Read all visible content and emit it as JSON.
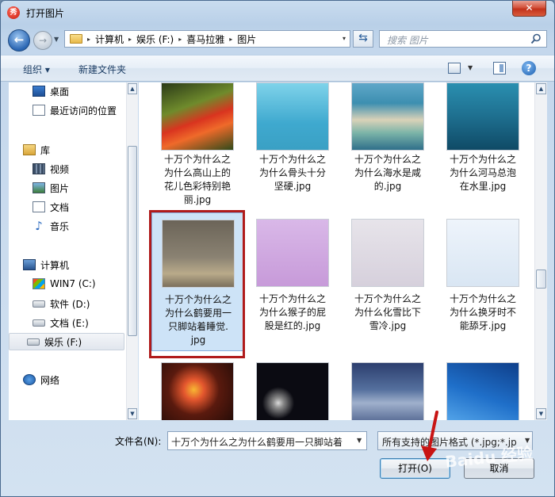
{
  "window": {
    "title": "打开图片",
    "app_icon_glyph": "秀",
    "close_glyph": "✕"
  },
  "address_bar": {
    "breadcrumbs": [
      "计算机",
      "娱乐 (F:)",
      "喜马拉雅",
      "图片"
    ],
    "separator": "▸",
    "dropdown_glyph": "▾"
  },
  "search": {
    "placeholder": "搜索 图片"
  },
  "toolbar": {
    "organize_label": "组织 ▾",
    "new_folder_label": "新建文件夹",
    "help_glyph": "?"
  },
  "nav_pane": {
    "items": [
      {
        "label": "桌面",
        "icon": "desktop-icon"
      },
      {
        "label": "最近访问的位置",
        "icon": "recent-places-icon"
      },
      {
        "label": "库",
        "icon": "library-icon"
      },
      {
        "label": "视频",
        "icon": "video-icon"
      },
      {
        "label": "图片",
        "icon": "pictures-icon"
      },
      {
        "label": "文档",
        "icon": "documents-icon"
      },
      {
        "label": "音乐",
        "icon": "music-icon"
      },
      {
        "label": "计算机",
        "icon": "computer-icon"
      },
      {
        "label": "WIN7 (C:)",
        "icon": "windows-drive-icon"
      },
      {
        "label": "软件 (D:)",
        "icon": "drive-icon"
      },
      {
        "label": "文档 (E:)",
        "icon": "drive-icon"
      },
      {
        "label": "娱乐 (F:)",
        "icon": "drive-icon"
      },
      {
        "label": "网络",
        "icon": "network-icon"
      }
    ],
    "selected_index": 11
  },
  "files": [
    {
      "label": "十万个为什么之\n为什么高山上的\n花儿色彩特别艳\n丽.jpg"
    },
    {
      "label": "十万个为什么之\n为什么骨头十分\n坚硬.jpg"
    },
    {
      "label": "十万个为什么之\n为什么海水是咸\n的.jpg"
    },
    {
      "label": "十万个为什么之\n为什么河马总泡\n在水里.jpg"
    },
    {
      "label": "十万个为什么之\n为什么鹤要用一\n只脚站着睡觉.\njpg"
    },
    {
      "label": "十万个为什么之\n为什么猴子的屁\n股是红的.jpg"
    },
    {
      "label": "十万个为什么之\n为什么化雪比下\n雪冷.jpg"
    },
    {
      "label": "十万个为什么之\n为什么换牙时不\n能舔牙.jpg"
    },
    {
      "label": ""
    },
    {
      "label": ""
    },
    {
      "label": ""
    },
    {
      "label": ""
    }
  ],
  "selected_file_index": 4,
  "bottom": {
    "filename_label": "文件名(N):",
    "filename_value": "十万个为什么之为什么鹤要用一只脚站着",
    "filter_value": "所有支持的图片格式 (*.jpg;*.jp",
    "open_label": "打开(O)",
    "cancel_label": "取消"
  },
  "watermark_text": "Baidu 经验",
  "colors": {
    "highlight_border": "#b01b1b",
    "selection_bg": "#cde3f7",
    "accent": "#2a66b3"
  }
}
